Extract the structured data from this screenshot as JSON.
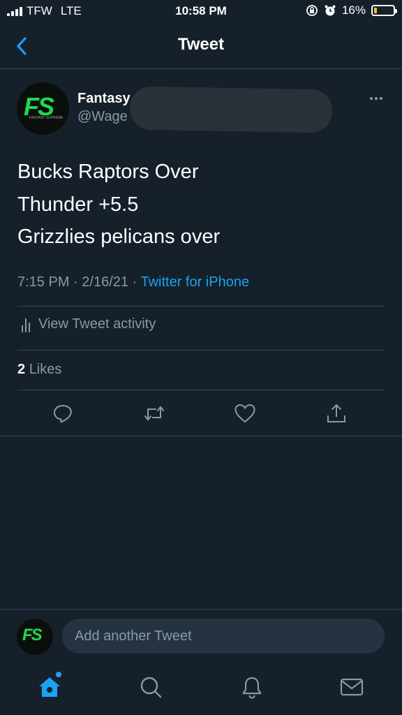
{
  "status_bar": {
    "carrier": "TFW",
    "network": "LTE",
    "time": "10:58 PM",
    "battery": "16%",
    "battery_level": 0.16,
    "icons": [
      "signal-icon",
      "rotation-lock-icon",
      "alarm-icon",
      "battery-icon"
    ]
  },
  "nav": {
    "title": "Tweet",
    "back_icon": "chevron-left-icon"
  },
  "tweet": {
    "display_name": "Fantasy",
    "handle": "@Wage",
    "lines": [
      "Bucks Raptors Over",
      "Thunder +5.5",
      "Grizzlies pelicans over"
    ],
    "time": "7:15 PM",
    "separator": "·",
    "date": "2/16/21",
    "source": "Twitter for iPhone",
    "activity_label": "View Tweet activity",
    "likes_count": "2",
    "likes_label": "Likes",
    "avatar_text": "FS",
    "avatar_subtext": "FANTASY SUPREME"
  },
  "compose": {
    "placeholder": "Add another Tweet",
    "avatar_text": "FS"
  },
  "colors": {
    "background": "#15202b",
    "accent": "#1da1f2",
    "muted": "#8899a6",
    "divider": "#38444d",
    "logo_green": "#22d84a"
  },
  "tab_bar": {
    "items": [
      "home-icon",
      "search-icon",
      "notifications-icon",
      "messages-icon"
    ]
  }
}
